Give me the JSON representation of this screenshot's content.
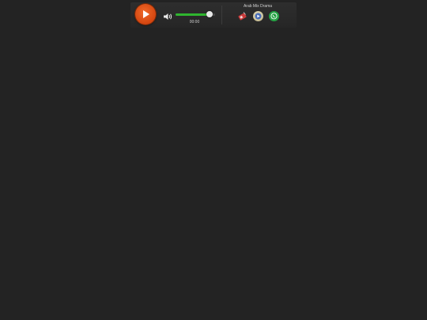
{
  "player": {
    "time": "00:00",
    "station_name": "Arab Mix Drama",
    "volume": 0.85
  },
  "icons": {
    "play": "play-icon",
    "speaker": "speaker-icon",
    "share_1": "radio-share-icon",
    "share_2": "media-player-icon",
    "share_3": "whatsapp-icon"
  },
  "colors": {
    "play_button": "#e0541b",
    "volume_fill": "#2fb52f",
    "background": "#232323",
    "whatsapp": "#25a244"
  }
}
